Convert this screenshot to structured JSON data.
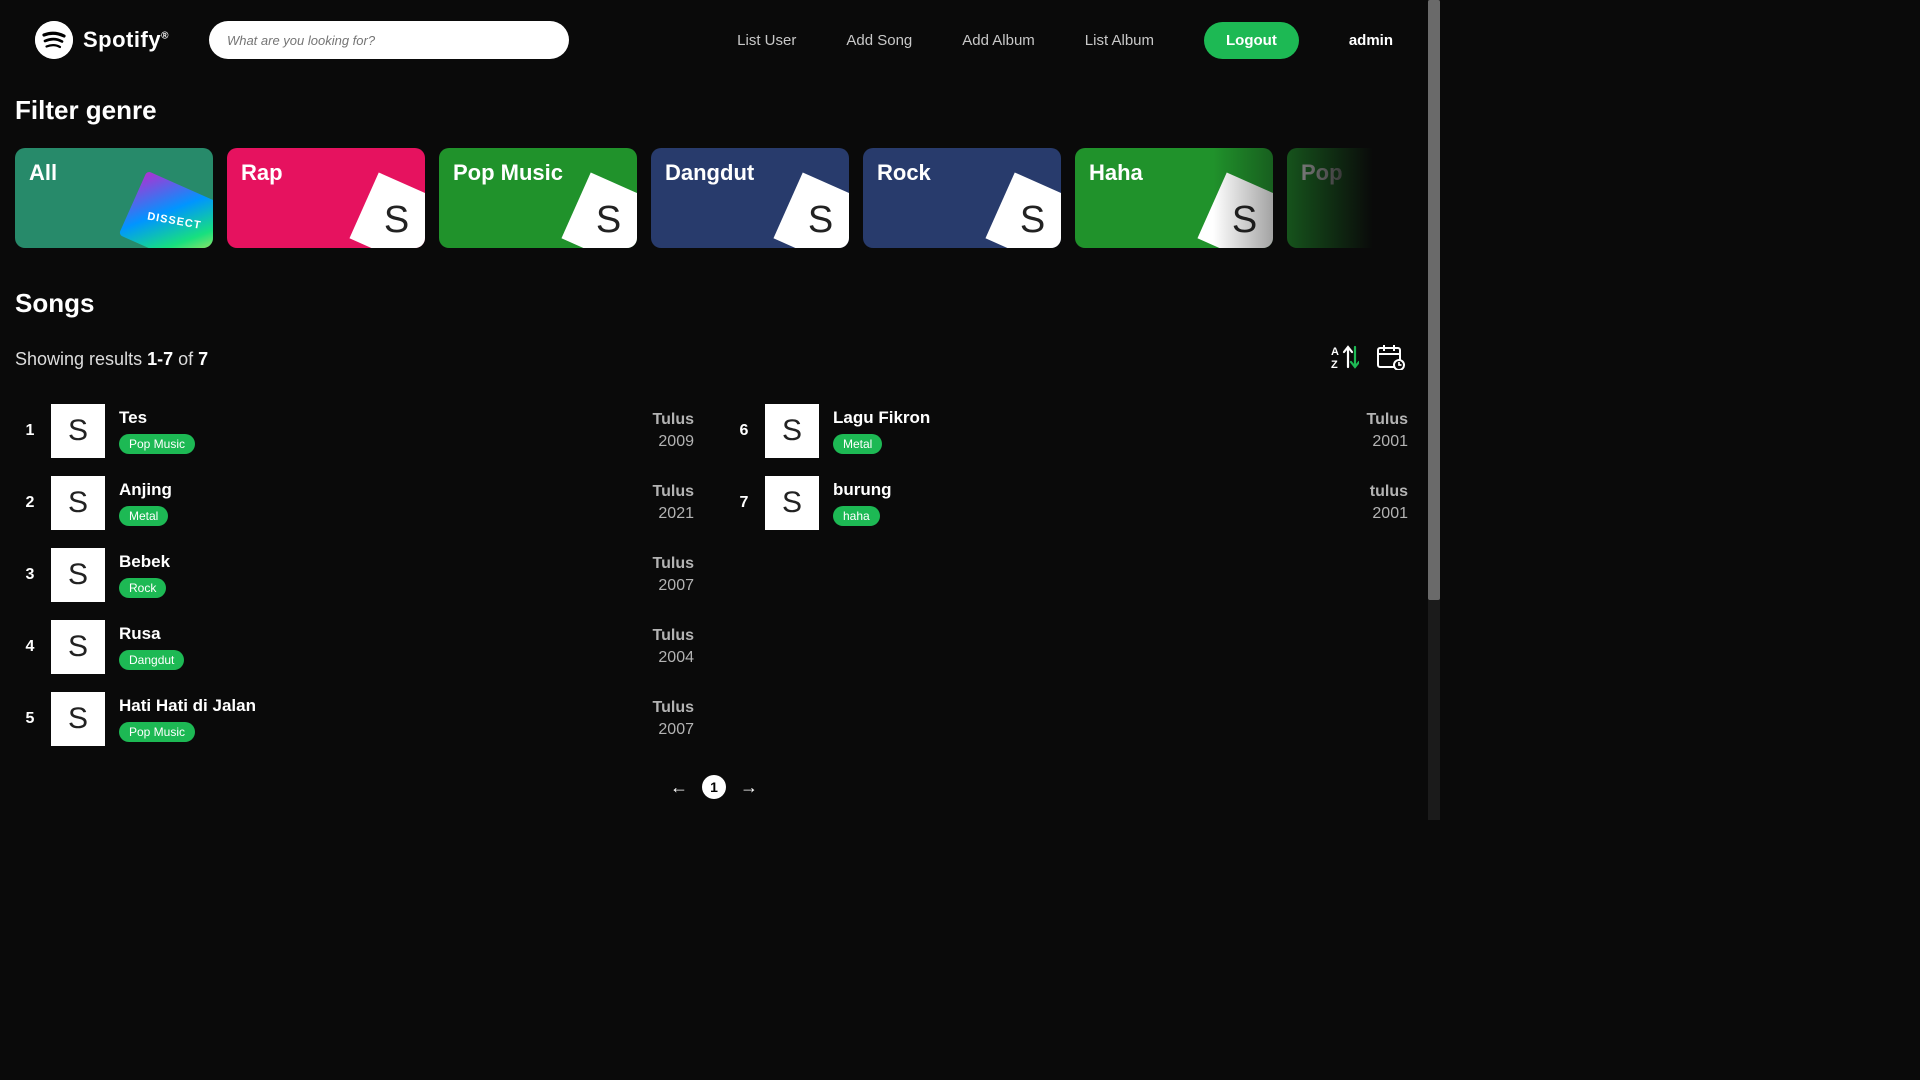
{
  "header": {
    "brand": "Spotify",
    "search_placeholder": "What are you looking for?",
    "nav": [
      "List User",
      "Add Song",
      "Add Album",
      "List Album"
    ],
    "logout_label": "Logout",
    "user_label": "admin"
  },
  "filter": {
    "title": "Filter genre",
    "genres": [
      {
        "name": "All",
        "color": "#278a6a",
        "special": "all"
      },
      {
        "name": "Rap",
        "color": "#e6125f"
      },
      {
        "name": "Pop Music",
        "color": "#20922b"
      },
      {
        "name": "Dangdut",
        "color": "#283b6c"
      },
      {
        "name": "Rock",
        "color": "#283b6c"
      },
      {
        "name": "Haha",
        "color": "#20922b"
      },
      {
        "name": "Pop",
        "color": "#20922b"
      }
    ],
    "card_glyph": "S",
    "all_card_text": "DISSECT"
  },
  "songs": {
    "title": "Songs",
    "results_prefix": "Showing results ",
    "range": "1-7",
    "of_word": " of ",
    "total": "7",
    "items": [
      {
        "idx": "1",
        "title": "Tes",
        "genre": "Pop Music",
        "artist": "Tulus",
        "year": "2009"
      },
      {
        "idx": "2",
        "title": "Anjing",
        "genre": "Metal",
        "artist": "Tulus",
        "year": "2021"
      },
      {
        "idx": "3",
        "title": "Bebek",
        "genre": "Rock",
        "artist": "Tulus",
        "year": "2007"
      },
      {
        "idx": "4",
        "title": "Rusa",
        "genre": "Dangdut",
        "artist": "Tulus",
        "year": "2004"
      },
      {
        "idx": "5",
        "title": "Hati Hati di Jalan",
        "genre": "Pop Music",
        "artist": "Tulus",
        "year": "2007"
      },
      {
        "idx": "6",
        "title": "Lagu Fikron",
        "genre": "Metal",
        "artist": "Tulus",
        "year": "2001"
      },
      {
        "idx": "7",
        "title": "burung",
        "genre": "haha",
        "artist": "tulus",
        "year": "2001"
      }
    ],
    "art_glyph": "S"
  },
  "pagination": {
    "current": "1"
  }
}
